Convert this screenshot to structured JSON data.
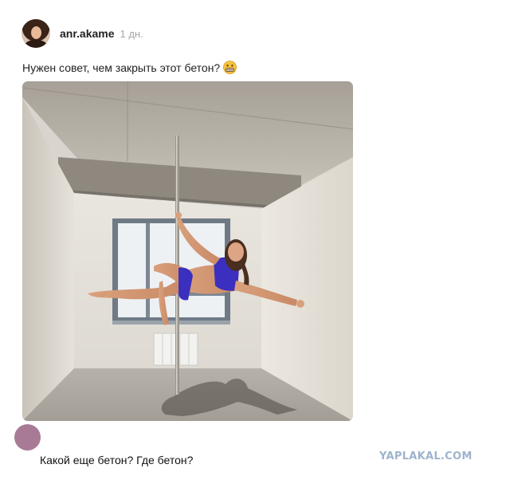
{
  "post": {
    "author": "anr.akame",
    "time": "1 дн.",
    "text": "Нужен совет, чем закрыть этот бетон?",
    "emoji_icon": "grimacing-face-emoji"
  },
  "comment": {
    "text": "Какой еще бетон? Где бетон?",
    "avatar_color": "#a87a95"
  },
  "watermark": "YAPLAKAL.COM",
  "colors": {
    "watermark": "#9db3cc",
    "username": "#222222",
    "timestamp": "#a6a6a6",
    "outfit": "#3b2fbf"
  }
}
